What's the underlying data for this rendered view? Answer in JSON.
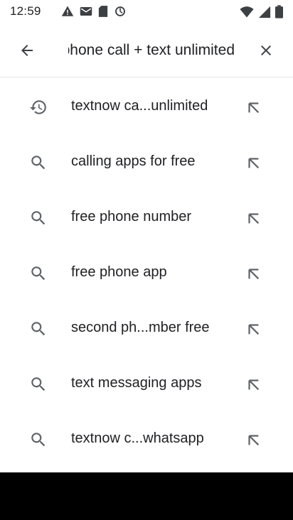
{
  "status_bar": {
    "time": "12:59",
    "left_icons": [
      "alert-triangle-icon",
      "gmail-icon",
      "sd-card-icon",
      "sync-icon"
    ],
    "right_icons": [
      "wifi-icon",
      "signal-icon",
      "battery-icon"
    ]
  },
  "search": {
    "query": "free phone call + text unlimited",
    "back_icon": "arrow-back-icon",
    "clear_icon": "close-icon"
  },
  "suggestions": [
    {
      "type": "history",
      "label": "textnow ca...unlimited"
    },
    {
      "type": "search",
      "label": "calling apps for free"
    },
    {
      "type": "search",
      "label": "free phone number"
    },
    {
      "type": "search",
      "label": "free phone app"
    },
    {
      "type": "search",
      "label": "second ph...mber free"
    },
    {
      "type": "search",
      "label": "text messaging apps"
    },
    {
      "type": "search",
      "label": "textnow c...whatsapp"
    }
  ],
  "colors": {
    "icon": "#5f6368",
    "text": "#202124",
    "nav_bar": "#000000"
  }
}
